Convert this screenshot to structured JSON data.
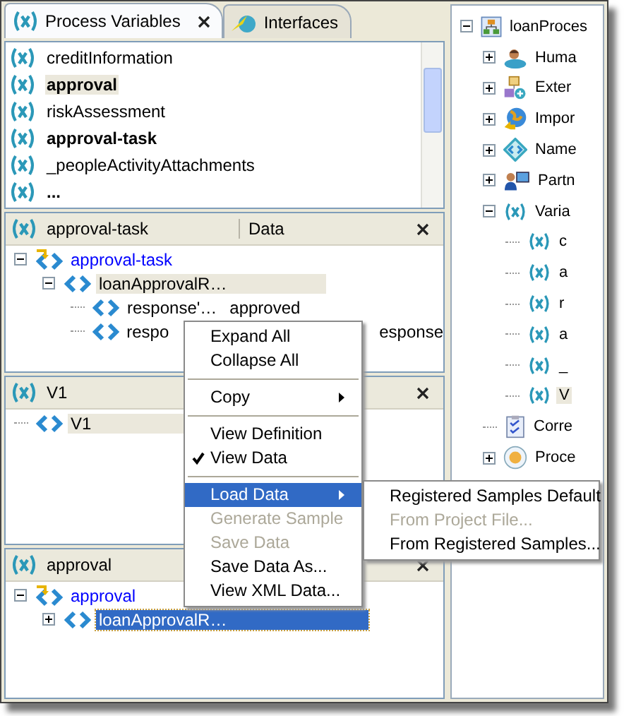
{
  "left_panel": {
    "tabs": [
      {
        "label": "Process Variables",
        "selected": true
      },
      {
        "label": "Interfaces",
        "selected": false
      }
    ],
    "variables": [
      {
        "name": "creditInformation",
        "bold": false,
        "selected": false
      },
      {
        "name": "approval",
        "bold": true,
        "selected": true
      },
      {
        "name": "riskAssessment",
        "bold": false,
        "selected": false
      },
      {
        "name": "approval-task",
        "bold": true,
        "selected": false
      },
      {
        "name": "_peopleActivityAttachments",
        "bold": false,
        "selected": false
      },
      {
        "name": "...",
        "bold": true,
        "selected": false
      }
    ],
    "panes": [
      {
        "title": "approval-task",
        "column": "Data",
        "active": false,
        "tree": [
          {
            "label": "approval-task",
            "kind": "root",
            "expanded": true,
            "selected": false,
            "children": [
              {
                "label": "loanApprovalR…",
                "kind": "element",
                "expanded": true,
                "selected": true,
                "children": [
                  {
                    "label": "response'…",
                    "kind": "element",
                    "selected": false,
                    "value": "approved"
                  },
                  {
                    "label": "respo",
                    "kind": "element",
                    "selected": false,
                    "value": "esponse"
                  }
                ]
              }
            ]
          }
        ]
      },
      {
        "title": "V1",
        "active": false,
        "tree": [
          {
            "label": "V1",
            "kind": "element",
            "selected": true
          }
        ]
      },
      {
        "title": "approval",
        "active": true,
        "tree": [
          {
            "label": "approval",
            "kind": "root",
            "expanded": true,
            "selected": false,
            "children": [
              {
                "label": "loanApprovalR…",
                "kind": "element",
                "expanded": false,
                "selected": true
              }
            ]
          }
        ]
      }
    ]
  },
  "right_panel": {
    "tree": [
      {
        "label": "loanProces",
        "kind": "process",
        "expanded": true,
        "children": [
          {
            "label": "Huma",
            "kind": "person",
            "expanded": false
          },
          {
            "label": "Exter",
            "kind": "external",
            "expanded": false
          },
          {
            "label": "Impor",
            "kind": "import",
            "expanded": false
          },
          {
            "label": "Name",
            "kind": "namespace",
            "expanded": false
          },
          {
            "label": "Partn",
            "kind": "partner",
            "expanded": false
          },
          {
            "label": "Varia",
            "kind": "variable",
            "expanded": true,
            "children": [
              {
                "label": "c",
                "kind": "variable",
                "selected": false
              },
              {
                "label": "a",
                "kind": "variable",
                "selected": false
              },
              {
                "label": "r",
                "kind": "variable",
                "selected": false
              },
              {
                "label": "a",
                "kind": "variable",
                "selected": false
              },
              {
                "label": "_",
                "kind": "variable",
                "selected": false
              },
              {
                "label": "V",
                "kind": "variable",
                "selected": true
              }
            ]
          },
          {
            "label": "Corre",
            "kind": "correlation"
          },
          {
            "label": "Proce",
            "kind": "activity",
            "expanded": false
          }
        ]
      }
    ]
  },
  "context_menu": {
    "items": [
      {
        "kind": "item",
        "label": "Expand All",
        "disabled": false,
        "checked": false,
        "selected": false
      },
      {
        "kind": "item",
        "label": "Collapse All",
        "disabled": false,
        "checked": false,
        "selected": false
      },
      {
        "kind": "separator"
      },
      {
        "kind": "submenu",
        "label": "Copy",
        "disabled": false,
        "checked": false,
        "selected": false
      },
      {
        "kind": "separator"
      },
      {
        "kind": "item",
        "label": "View Definition",
        "disabled": false,
        "checked": false,
        "selected": false
      },
      {
        "kind": "item",
        "label": "View Data",
        "disabled": false,
        "checked": true,
        "selected": false
      },
      {
        "kind": "separator"
      },
      {
        "kind": "submenu",
        "label": "Load Data",
        "disabled": false,
        "checked": false,
        "selected": true
      },
      {
        "kind": "item",
        "label": "Generate Sample",
        "disabled": true,
        "checked": false,
        "selected": false
      },
      {
        "kind": "item",
        "label": "Save Data",
        "disabled": true,
        "checked": false,
        "selected": false
      },
      {
        "kind": "item",
        "label": "Save Data As...",
        "disabled": false,
        "checked": false,
        "selected": false
      },
      {
        "kind": "item",
        "label": "View XML Data...",
        "disabled": false,
        "checked": false,
        "selected": false
      }
    ],
    "submenu": [
      {
        "label": "Registered Samples Default",
        "disabled": false
      },
      {
        "label": "From Project File...",
        "disabled": true
      },
      {
        "label": "From Registered Samples...",
        "disabled": false
      }
    ]
  }
}
